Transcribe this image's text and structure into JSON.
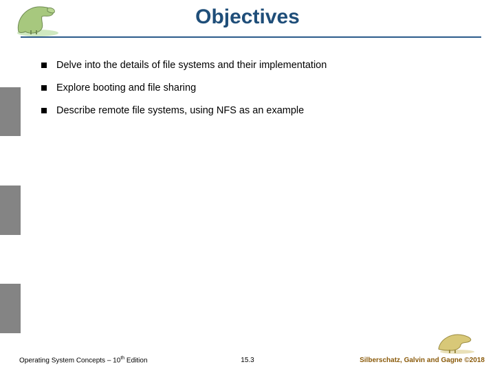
{
  "title": "Objectives",
  "bullets": [
    "Delve into the details of file systems and their implementation",
    "Explore booting and file sharing",
    "Describe remote file systems, using NFS as an example"
  ],
  "footer": {
    "left_prefix": "Operating System Concepts – 10",
    "left_suffix": " Edition",
    "left_sup": "th",
    "center": "15.3",
    "right": "Silberschatz, Galvin and Gagne ©2018"
  },
  "colors": {
    "title": "#1f4e79",
    "rule": "#2a5a8a",
    "sidebar_gray": "#848484",
    "copyright": "#8a5a0a"
  }
}
